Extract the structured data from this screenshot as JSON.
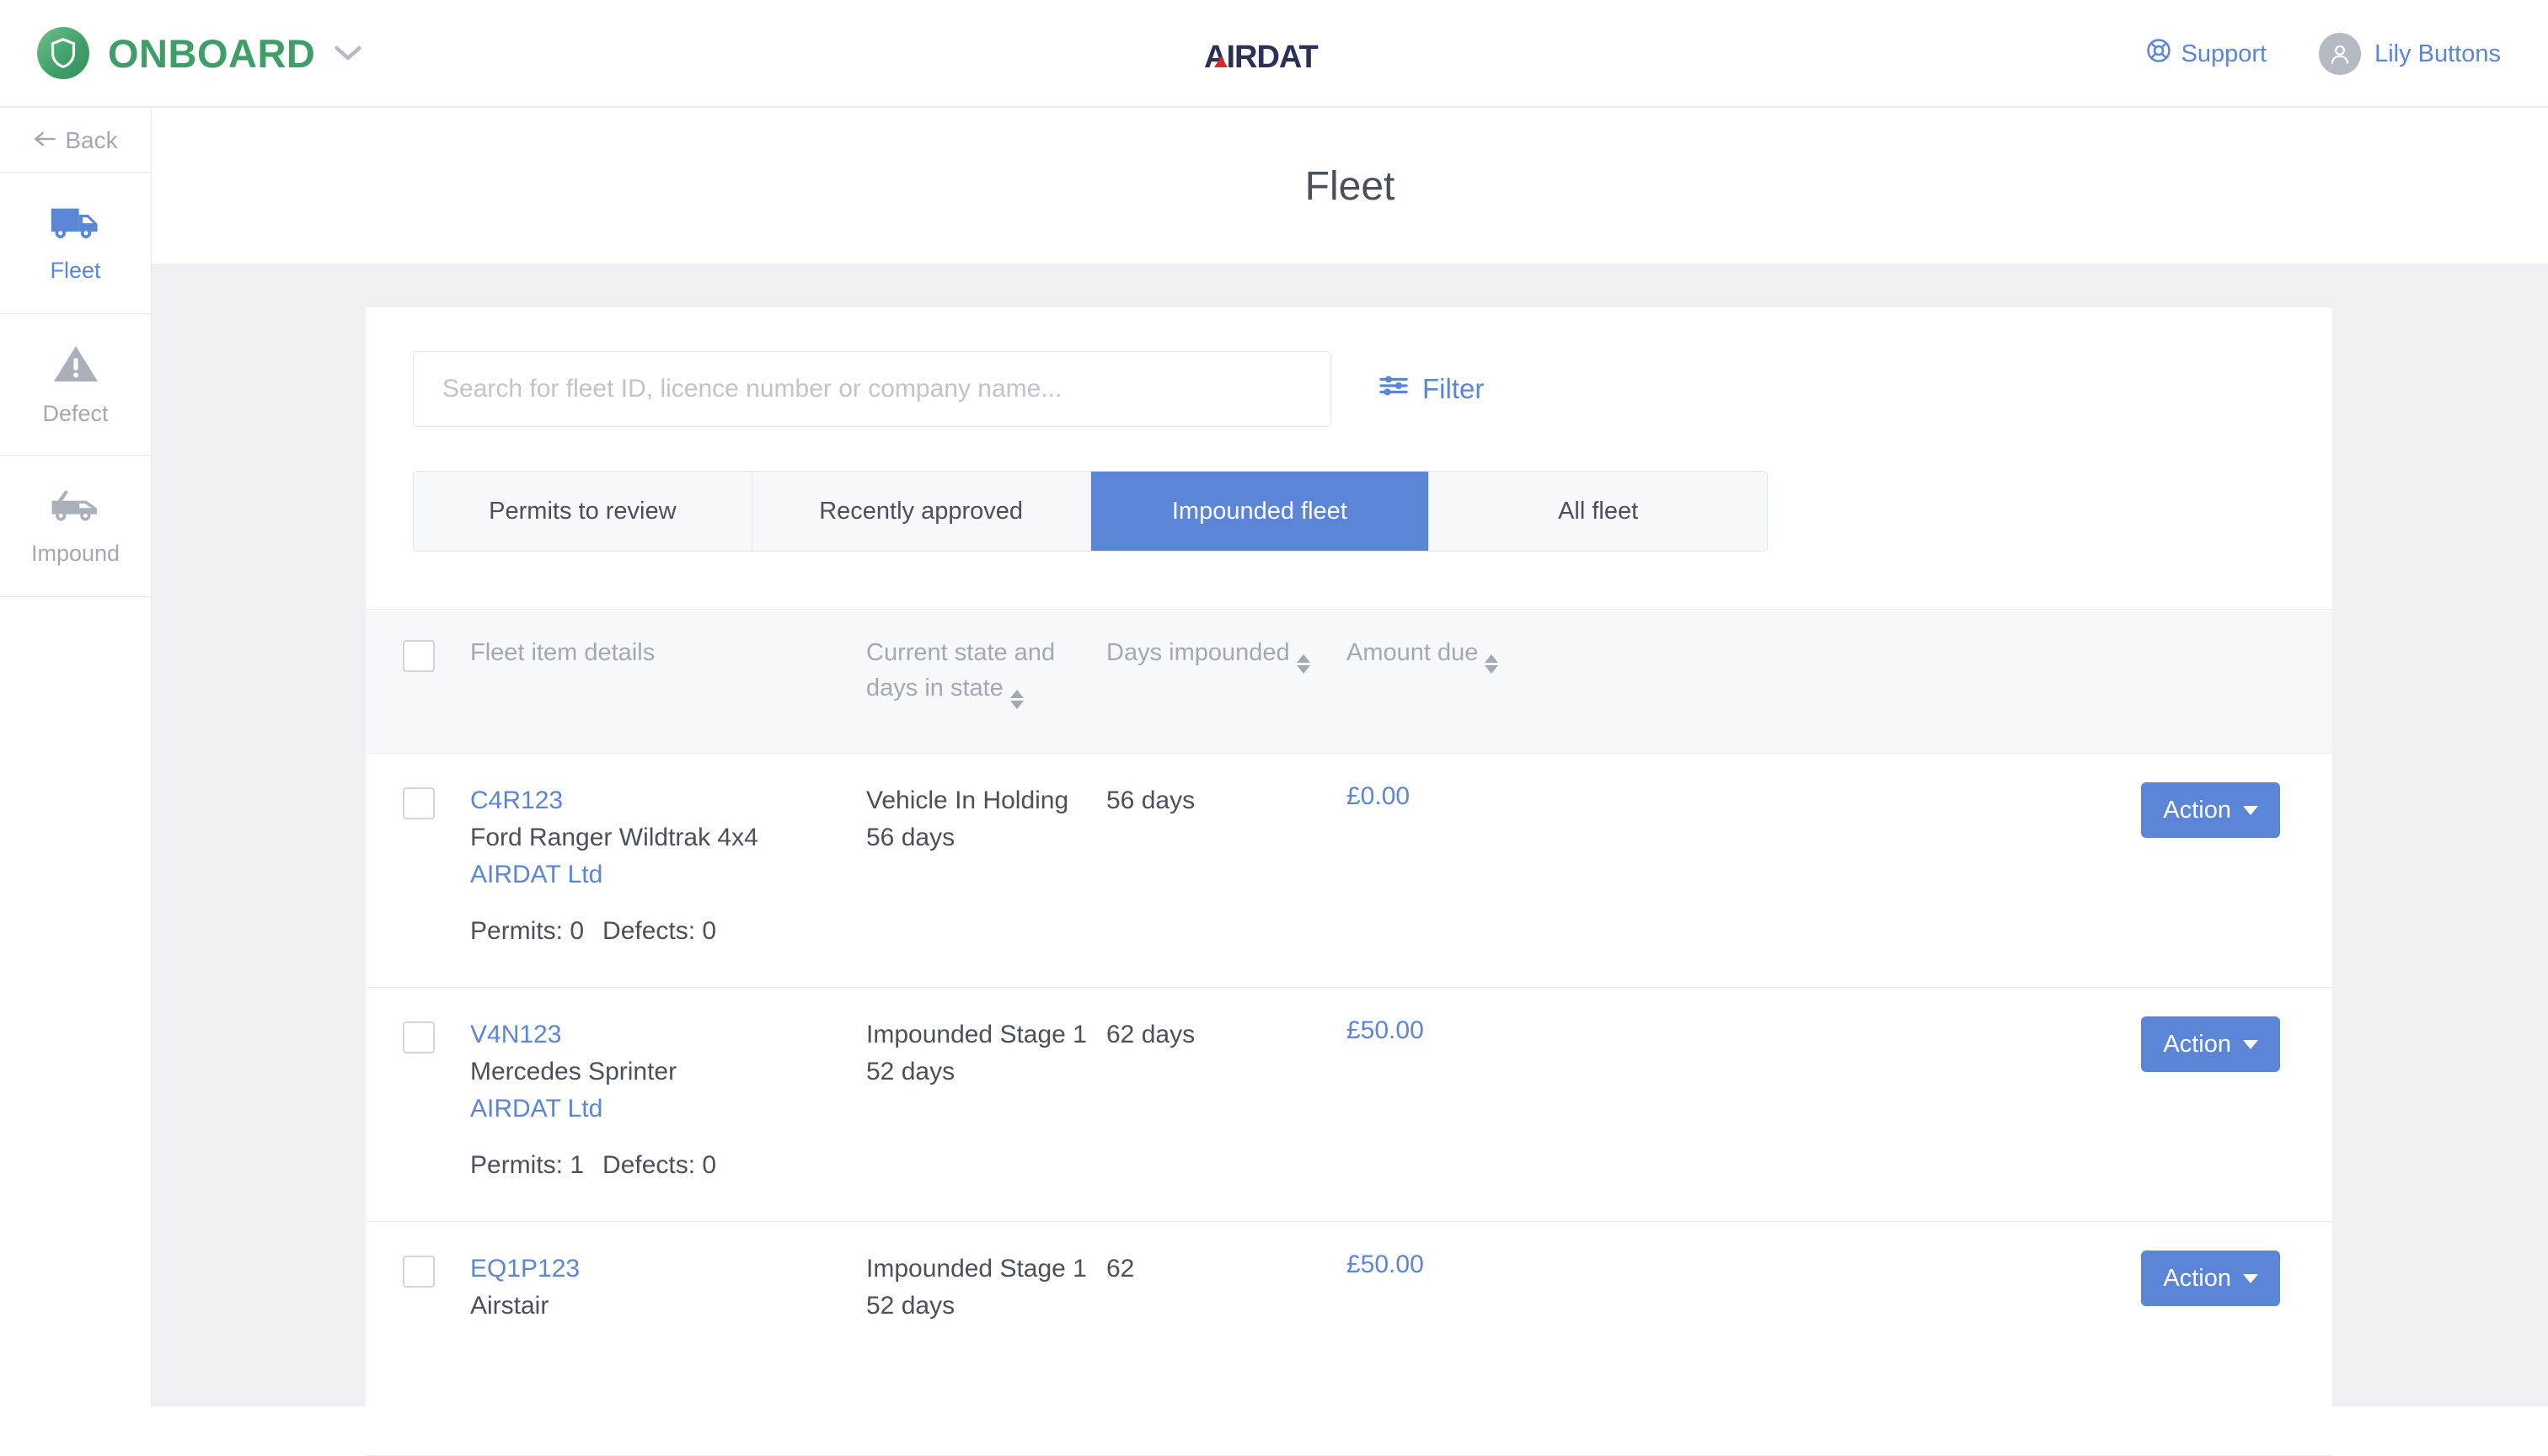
{
  "topbar": {
    "brand_name": "ONBOARD",
    "brand_icon": "shield-icon",
    "brand_caret_icon": "chevron-down-icon",
    "center_logo_text": "AIRDAT",
    "support_label": "Support",
    "support_icon": "lifebuoy-icon",
    "user_name": "Lily Buttons",
    "user_icon": "user-avatar-icon",
    "brand_color": "#3f9e67",
    "accent_color": "#5b85d6"
  },
  "sidebar": {
    "back_label": "Back",
    "back_icon": "arrow-left-icon",
    "items": [
      {
        "label": "Fleet",
        "icon": "truck-icon",
        "active": true
      },
      {
        "label": "Defect",
        "icon": "warning-triangle-icon",
        "active": false
      },
      {
        "label": "Impound",
        "icon": "tow-truck-icon",
        "active": false
      }
    ]
  },
  "page": {
    "title": "Fleet"
  },
  "search": {
    "value": "",
    "placeholder": "Search for fleet ID, licence number or company name...",
    "filter_label": "Filter",
    "filter_icon": "sliders-icon"
  },
  "tabs": [
    {
      "label": "Permits to review",
      "active": false
    },
    {
      "label": "Recently approved",
      "active": false
    },
    {
      "label": "Impounded fleet",
      "active": true
    },
    {
      "label": "All fleet",
      "active": false
    }
  ],
  "table": {
    "headers": {
      "details": "Fleet item details",
      "state": "Current state and days in state",
      "days": "Days impounded",
      "amount": "Amount due"
    },
    "rows": [
      {
        "fleet_id": "C4R123",
        "vehicle": "Ford Ranger Wildtrak 4x4",
        "company": "AIRDAT Ltd",
        "permits": "Permits: 0",
        "defects": "Defects: 0",
        "state": "Vehicle In Holding",
        "state_days": "56 days",
        "days_impounded": "56 days",
        "amount_due": "£0.00",
        "action_label": "Action"
      },
      {
        "fleet_id": "V4N123",
        "vehicle": "Mercedes Sprinter",
        "company": "AIRDAT Ltd",
        "permits": "Permits: 1",
        "defects": "Defects: 0",
        "state": "Impounded Stage 1",
        "state_days": "52 days",
        "days_impounded": "62 days",
        "amount_due": "£50.00",
        "action_label": "Action"
      },
      {
        "fleet_id": "EQ1P123",
        "vehicle": "Airstair",
        "company": "",
        "permits": "",
        "defects": "",
        "state": "Impounded Stage 1",
        "state_days": "52 days",
        "days_impounded": "62",
        "amount_due": "£50.00",
        "action_label": "Action"
      }
    ]
  }
}
